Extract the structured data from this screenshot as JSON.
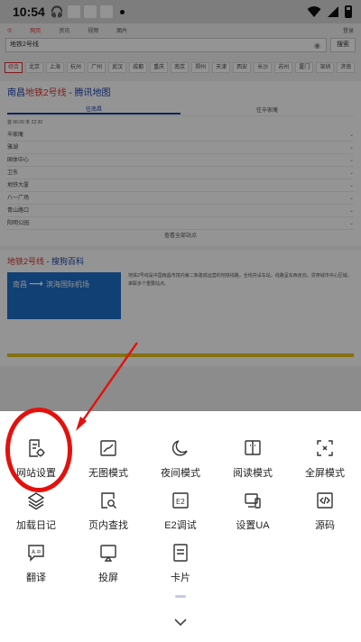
{
  "status_bar": {
    "time": "10:54"
  },
  "background_page": {
    "nav": [
      "网页",
      "资讯",
      "视频",
      "图片",
      "知道",
      "文库"
    ],
    "nav_right": "登录",
    "search_value": "地铁2号线",
    "search_button": "搜索",
    "categories": [
      "综合",
      "北京",
      "上海",
      "杭州",
      "广州",
      "武汉",
      "成都",
      "重庆",
      "南京",
      "郑州",
      "天津",
      "西安",
      "长沙",
      "苏州",
      "厦门",
      "深圳",
      "济南"
    ],
    "result1": {
      "title_prefix": "南昌",
      "title_highlight": "地铁2号线",
      "title_suffix": " - 腾讯地图",
      "tabs": [
        "往南昌",
        "往辛家庵"
      ],
      "legend": "首 06:00 末 22:30",
      "stops": [
        "辛家庵",
        "雅湖",
        "国体中心",
        "卫东",
        "地铁大厦",
        "八一广场",
        "青山路口",
        "阳明公园"
      ],
      "more": "查看全部站点"
    },
    "result2": {
      "title_highlight": "地铁2号线",
      "title_suffix": " - 搜狗百科",
      "image_from": "南昌",
      "image_to": "滨海国际机场",
      "description": "地铁2号线是中国南昌市境内第二条建成运营的地铁线路，全线共设车站，线路呈东西走向，贯穿城市中心区域，串联多个重要站点。"
    }
  },
  "menu": {
    "rows": [
      [
        {
          "id": "site-settings",
          "label": "网站设置",
          "icon": "site-settings-icon"
        },
        {
          "id": "no-image-mode",
          "label": "无图模式",
          "icon": "no-image-icon"
        },
        {
          "id": "night-mode",
          "label": "夜间模式",
          "icon": "moon-icon"
        },
        {
          "id": "reader-mode",
          "label": "阅读模式",
          "icon": "reader-icon"
        },
        {
          "id": "fullscreen-mode",
          "label": "全屏模式",
          "icon": "fullscreen-icon"
        }
      ],
      [
        {
          "id": "load-log",
          "label": "加载日记",
          "icon": "layers-icon"
        },
        {
          "id": "find-in-page",
          "label": "页内查找",
          "icon": "find-in-page-icon"
        },
        {
          "id": "e2-debug",
          "label": "E2调试",
          "icon": "e2-icon"
        },
        {
          "id": "set-ua",
          "label": "设置UA",
          "icon": "devices-icon"
        },
        {
          "id": "source-code",
          "label": "源码",
          "icon": "code-icon"
        }
      ],
      [
        {
          "id": "translate",
          "label": "翻译",
          "icon": "translate-icon"
        },
        {
          "id": "cast-screen",
          "label": "投屏",
          "icon": "cast-icon"
        },
        {
          "id": "card",
          "label": "卡片",
          "icon": "card-icon"
        }
      ]
    ],
    "icon_color": "#333333"
  },
  "annotation": {
    "color": "#e3110d"
  }
}
